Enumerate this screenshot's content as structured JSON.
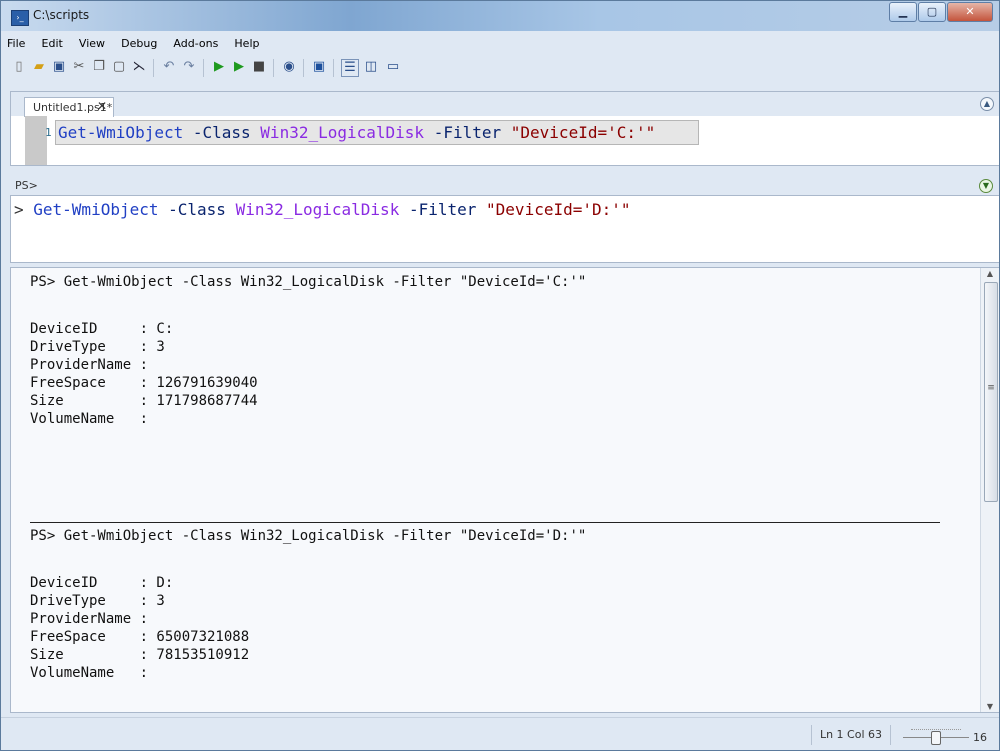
{
  "window": {
    "title": "C:\\scripts",
    "icon": "powershell-ise-icon"
  },
  "menu": [
    "File",
    "Edit",
    "View",
    "Debug",
    "Add-ons",
    "Help"
  ],
  "toolbar_icons": [
    "new-icon",
    "open-icon",
    "save-icon",
    "cut-icon",
    "copy-icon",
    "paste-icon",
    "clear-console-icon",
    "undo-icon",
    "redo-icon",
    "run-icon",
    "run-selection-icon",
    "stop-icon",
    "remote-icon",
    "powershell-icon",
    "layout-top-icon",
    "layout-right-icon",
    "layout-max-icon"
  ],
  "script_tab": {
    "label": "Untitled1.ps1*",
    "close": "✕"
  },
  "script_line": {
    "number": "1",
    "cmd": "Get-WmiObject",
    "p1": " -Class ",
    "type": "Win32_LogicalDisk",
    "p2": " -Filter ",
    "str": "\"DeviceId='C:'\""
  },
  "console_prompt": {
    "label": "PS>",
    "prefix": "> ",
    "cmd": "Get-WmiObject",
    "p1": " -Class ",
    "type": "Win32_LogicalDisk",
    "p2": " -Filter ",
    "str": "\"DeviceId='D:'\""
  },
  "output": {
    "block1": {
      "command": "PS> Get-WmiObject -Class Win32_LogicalDisk -Filter \"DeviceId='C:'\"",
      "lines": [
        "DeviceID     : C:",
        "DriveType    : 3",
        "ProviderName :",
        "FreeSpace    : 126791639040",
        "Size         : 171798687744",
        "VolumeName   :"
      ]
    },
    "block2": {
      "command": "PS> Get-WmiObject -Class Win32_LogicalDisk -Filter \"DeviceId='D:'\"",
      "lines": [
        "DeviceID     : D:",
        "DriveType    : 3",
        "ProviderName :",
        "FreeSpace    : 65007321088",
        "Size         : 78153510912",
        "VolumeName   :"
      ]
    }
  },
  "status": {
    "position": "Ln 1  Col 63",
    "zoom": "16",
    "zoom_level": 0.5
  }
}
